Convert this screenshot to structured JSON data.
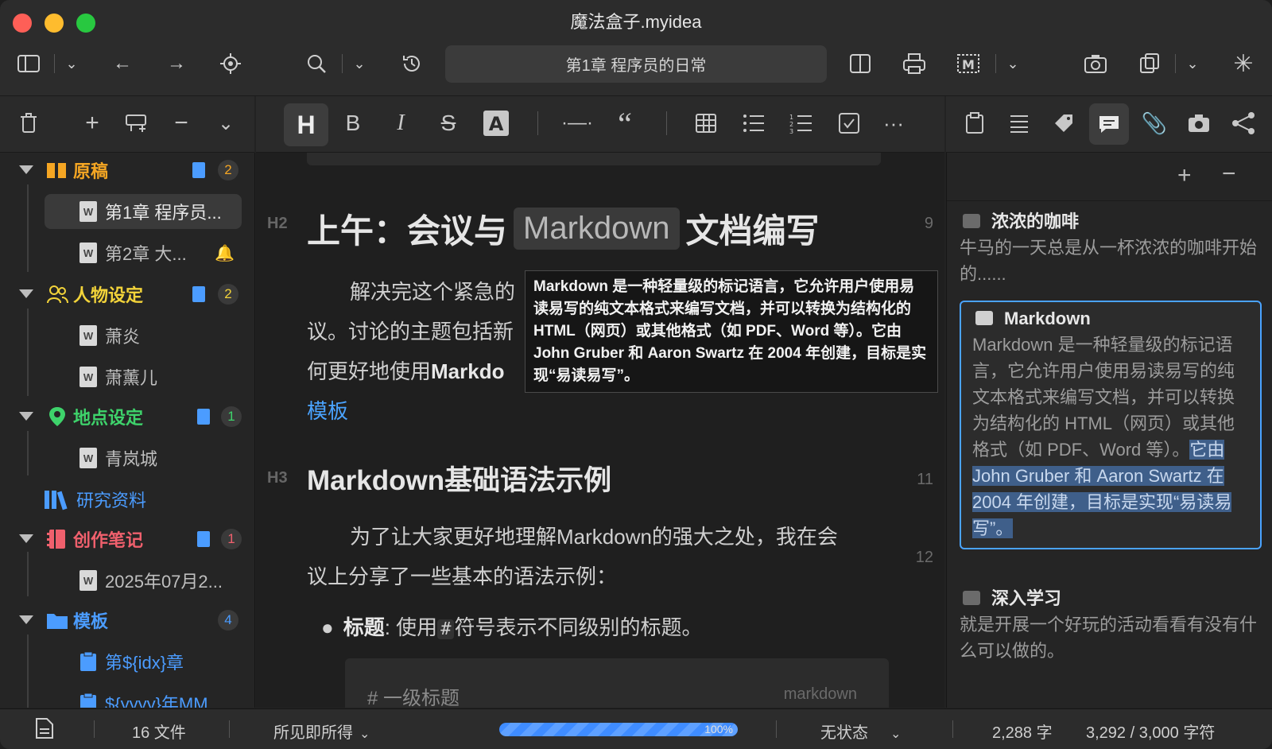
{
  "window": {
    "title": "魔法盒子.myidea"
  },
  "header": {
    "breadcrumb": "第1章 程序员的日常"
  },
  "colors": {
    "accent": "#4aa3ff",
    "orange": "#f5a623",
    "yellow": "#f2d33a",
    "green": "#3ed36b",
    "blue": "#4b9cff",
    "red": "#f0606d"
  },
  "sidebar": {
    "items": [
      {
        "label": "原稿",
        "count": "2"
      },
      {
        "label": "第1章 程序员..."
      },
      {
        "label": "第2章 大..."
      },
      {
        "label": "人物设定",
        "count": "2"
      },
      {
        "label": "萧炎"
      },
      {
        "label": "萧薰儿"
      },
      {
        "label": "地点设定",
        "count": "1"
      },
      {
        "label": "青岚城"
      },
      {
        "label": "研究资料"
      },
      {
        "label": "创作笔记",
        "count": "1"
      },
      {
        "label": "2025年07月2..."
      },
      {
        "label": "模板",
        "count": "4"
      },
      {
        "label": "第${idx}章"
      },
      {
        "label": "${yyyy}年MM"
      }
    ]
  },
  "editor": {
    "h2_mark": "H2",
    "h3_mark": "H3",
    "heading1_pre": "上午：会议与",
    "heading1_code": "Markdown",
    "heading1_post": "文档编写",
    "line_9": "9",
    "line_11": "11",
    "line_12": "12",
    "para1_line1": "解决完这个紧急的",
    "para1_line2": "议。讨论的主题包括新",
    "para1_line3_pre": "何更好地使用",
    "para1_line3_bold": "Markdo",
    "link_template": "模板",
    "heading2": "Markdown基础语法示例",
    "para2_line1": "为了让大家更好地理解Markdown的强大之处，我在会",
    "para2_line2": "议上分享了一些基本的语法示例：",
    "bullet_bold": "标题",
    "bullet_rest_pre": ": 使用",
    "bullet_code": "#",
    "bullet_rest_post": "符号表示不同级别的标题。",
    "code_line": "# 一级标题",
    "code_lang": "markdown",
    "tooltip": "Markdown 是一种轻量级的标记语言，它允许用户使用易读易写的纯文本格式来编写文档，并可以转换为结构化的 HTML（网页）或其他格式（如 PDF、Word 等）。它由 John Gruber 和 Aaron Swartz 在 2004 年创建，目标是实现“易读易写”。"
  },
  "notes": [
    {
      "title": "浓浓的咖啡",
      "body": "牛马的一天总是从一杯浓浓的咖啡开始的......"
    },
    {
      "title": "Markdown",
      "body": "Markdown 是一种轻量级的标记语言，它允许用户使用易读易写的纯文本格式来编写文档，并可以转换为结构化的 HTML（网页）或其他格式（如 PDF、Word 等）。",
      "body_selected": "它由 John Gruber 和 Aaron Swartz 在 2004 年创建，目标是实现“易读易写”。"
    },
    {
      "title": "深入学习",
      "body": "就是开展一个好玩的活动看看有没有什么可以做的。"
    }
  ],
  "status": {
    "files": "16 文件",
    "mode": "所见即所得",
    "progress": 1.0,
    "progress_label": "100%",
    "state": "无状态",
    "words": "2,288 字",
    "chars": "3,292 / 3,000 字符"
  }
}
